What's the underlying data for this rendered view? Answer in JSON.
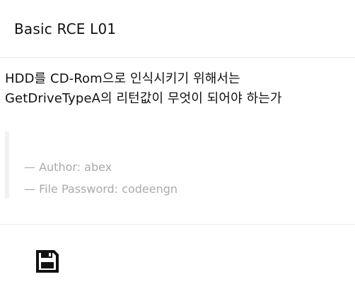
{
  "header": {
    "title": "Basic RCE L01"
  },
  "question": {
    "line1": "HDD를 CD-Rom으로 인식시키기 위해서는",
    "line2": "GetDriveTypeA의 리턴값이 무엇이 되어야 하는가"
  },
  "meta": {
    "author": "— Author: abex",
    "password": "— File Password: codeengn"
  },
  "actions": {
    "download_icon": "floppy-disk-icon"
  },
  "colors": {
    "text": "#111111",
    "muted": "#aaaaaa",
    "divider": "#ececec",
    "quote_bar": "#f2f2f2"
  }
}
